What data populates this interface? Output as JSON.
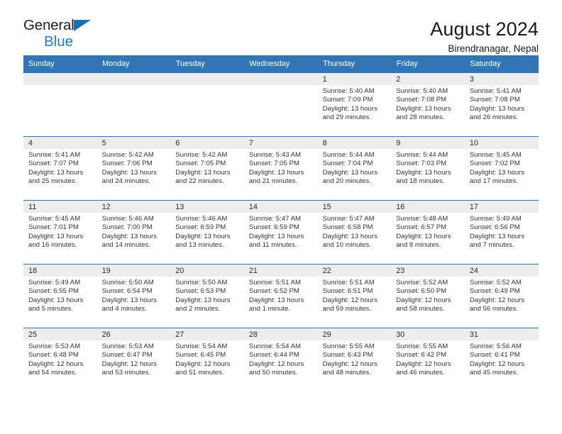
{
  "brand": {
    "line1": "General",
    "line2": "Blue",
    "flag_icon": "brand-flag-icon",
    "accent_color": "#1a6fb5"
  },
  "header": {
    "title": "August 2024",
    "subtitle": "Birendranagar, Nepal"
  },
  "theme": {
    "header_blue": "#3175b5",
    "cell_head_gray": "#ededed",
    "text": "#333333"
  },
  "weekday_headers": [
    "Sunday",
    "Monday",
    "Tuesday",
    "Wednesday",
    "Thursday",
    "Friday",
    "Saturday"
  ],
  "weeks": [
    [
      {
        "day": "",
        "sunrise": "",
        "sunset": "",
        "daylight1": "",
        "daylight2": ""
      },
      {
        "day": "",
        "sunrise": "",
        "sunset": "",
        "daylight1": "",
        "daylight2": ""
      },
      {
        "day": "",
        "sunrise": "",
        "sunset": "",
        "daylight1": "",
        "daylight2": ""
      },
      {
        "day": "",
        "sunrise": "",
        "sunset": "",
        "daylight1": "",
        "daylight2": ""
      },
      {
        "day": "1",
        "sunrise": "Sunrise: 5:40 AM",
        "sunset": "Sunset: 7:09 PM",
        "daylight1": "Daylight: 13 hours",
        "daylight2": "and 29 minutes."
      },
      {
        "day": "2",
        "sunrise": "Sunrise: 5:40 AM",
        "sunset": "Sunset: 7:08 PM",
        "daylight1": "Daylight: 13 hours",
        "daylight2": "and 28 minutes."
      },
      {
        "day": "3",
        "sunrise": "Sunrise: 5:41 AM",
        "sunset": "Sunset: 7:08 PM",
        "daylight1": "Daylight: 13 hours",
        "daylight2": "and 26 minutes."
      }
    ],
    [
      {
        "day": "4",
        "sunrise": "Sunrise: 5:41 AM",
        "sunset": "Sunset: 7:07 PM",
        "daylight1": "Daylight: 13 hours",
        "daylight2": "and 25 minutes."
      },
      {
        "day": "5",
        "sunrise": "Sunrise: 5:42 AM",
        "sunset": "Sunset: 7:06 PM",
        "daylight1": "Daylight: 13 hours",
        "daylight2": "and 24 minutes."
      },
      {
        "day": "6",
        "sunrise": "Sunrise: 5:42 AM",
        "sunset": "Sunset: 7:05 PM",
        "daylight1": "Daylight: 13 hours",
        "daylight2": "and 22 minutes."
      },
      {
        "day": "7",
        "sunrise": "Sunrise: 5:43 AM",
        "sunset": "Sunset: 7:05 PM",
        "daylight1": "Daylight: 13 hours",
        "daylight2": "and 21 minutes."
      },
      {
        "day": "8",
        "sunrise": "Sunrise: 5:44 AM",
        "sunset": "Sunset: 7:04 PM",
        "daylight1": "Daylight: 13 hours",
        "daylight2": "and 20 minutes."
      },
      {
        "day": "9",
        "sunrise": "Sunrise: 5:44 AM",
        "sunset": "Sunset: 7:03 PM",
        "daylight1": "Daylight: 13 hours",
        "daylight2": "and 18 minutes."
      },
      {
        "day": "10",
        "sunrise": "Sunrise: 5:45 AM",
        "sunset": "Sunset: 7:02 PM",
        "daylight1": "Daylight: 13 hours",
        "daylight2": "and 17 minutes."
      }
    ],
    [
      {
        "day": "11",
        "sunrise": "Sunrise: 5:45 AM",
        "sunset": "Sunset: 7:01 PM",
        "daylight1": "Daylight: 13 hours",
        "daylight2": "and 16 minutes."
      },
      {
        "day": "12",
        "sunrise": "Sunrise: 5:46 AM",
        "sunset": "Sunset: 7:00 PM",
        "daylight1": "Daylight: 13 hours",
        "daylight2": "and 14 minutes."
      },
      {
        "day": "13",
        "sunrise": "Sunrise: 5:46 AM",
        "sunset": "Sunset: 6:59 PM",
        "daylight1": "Daylight: 13 hours",
        "daylight2": "and 13 minutes."
      },
      {
        "day": "14",
        "sunrise": "Sunrise: 5:47 AM",
        "sunset": "Sunset: 6:59 PM",
        "daylight1": "Daylight: 13 hours",
        "daylight2": "and 11 minutes."
      },
      {
        "day": "15",
        "sunrise": "Sunrise: 5:47 AM",
        "sunset": "Sunset: 6:58 PM",
        "daylight1": "Daylight: 13 hours",
        "daylight2": "and 10 minutes."
      },
      {
        "day": "16",
        "sunrise": "Sunrise: 5:48 AM",
        "sunset": "Sunset: 6:57 PM",
        "daylight1": "Daylight: 13 hours",
        "daylight2": "and 8 minutes."
      },
      {
        "day": "17",
        "sunrise": "Sunrise: 5:49 AM",
        "sunset": "Sunset: 6:56 PM",
        "daylight1": "Daylight: 13 hours",
        "daylight2": "and 7 minutes."
      }
    ],
    [
      {
        "day": "18",
        "sunrise": "Sunrise: 5:49 AM",
        "sunset": "Sunset: 6:55 PM",
        "daylight1": "Daylight: 13 hours",
        "daylight2": "and 5 minutes."
      },
      {
        "day": "19",
        "sunrise": "Sunrise: 5:50 AM",
        "sunset": "Sunset: 6:54 PM",
        "daylight1": "Daylight: 13 hours",
        "daylight2": "and 4 minutes."
      },
      {
        "day": "20",
        "sunrise": "Sunrise: 5:50 AM",
        "sunset": "Sunset: 6:53 PM",
        "daylight1": "Daylight: 13 hours",
        "daylight2": "and 2 minutes."
      },
      {
        "day": "21",
        "sunrise": "Sunrise: 5:51 AM",
        "sunset": "Sunset: 6:52 PM",
        "daylight1": "Daylight: 13 hours",
        "daylight2": "and 1 minute."
      },
      {
        "day": "22",
        "sunrise": "Sunrise: 5:51 AM",
        "sunset": "Sunset: 6:51 PM",
        "daylight1": "Daylight: 12 hours",
        "daylight2": "and 59 minutes."
      },
      {
        "day": "23",
        "sunrise": "Sunrise: 5:52 AM",
        "sunset": "Sunset: 6:50 PM",
        "daylight1": "Daylight: 12 hours",
        "daylight2": "and 58 minutes."
      },
      {
        "day": "24",
        "sunrise": "Sunrise: 5:52 AM",
        "sunset": "Sunset: 6:49 PM",
        "daylight1": "Daylight: 12 hours",
        "daylight2": "and 56 minutes."
      }
    ],
    [
      {
        "day": "25",
        "sunrise": "Sunrise: 5:53 AM",
        "sunset": "Sunset: 6:48 PM",
        "daylight1": "Daylight: 12 hours",
        "daylight2": "and 54 minutes."
      },
      {
        "day": "26",
        "sunrise": "Sunrise: 5:53 AM",
        "sunset": "Sunset: 6:47 PM",
        "daylight1": "Daylight: 12 hours",
        "daylight2": "and 53 minutes."
      },
      {
        "day": "27",
        "sunrise": "Sunrise: 5:54 AM",
        "sunset": "Sunset: 6:45 PM",
        "daylight1": "Daylight: 12 hours",
        "daylight2": "and 51 minutes."
      },
      {
        "day": "28",
        "sunrise": "Sunrise: 5:54 AM",
        "sunset": "Sunset: 6:44 PM",
        "daylight1": "Daylight: 12 hours",
        "daylight2": "and 50 minutes."
      },
      {
        "day": "29",
        "sunrise": "Sunrise: 5:55 AM",
        "sunset": "Sunset: 6:43 PM",
        "daylight1": "Daylight: 12 hours",
        "daylight2": "and 48 minutes."
      },
      {
        "day": "30",
        "sunrise": "Sunrise: 5:55 AM",
        "sunset": "Sunset: 6:42 PM",
        "daylight1": "Daylight: 12 hours",
        "daylight2": "and 46 minutes."
      },
      {
        "day": "31",
        "sunrise": "Sunrise: 5:56 AM",
        "sunset": "Sunset: 6:41 PM",
        "daylight1": "Daylight: 12 hours",
        "daylight2": "and 45 minutes."
      }
    ]
  ]
}
